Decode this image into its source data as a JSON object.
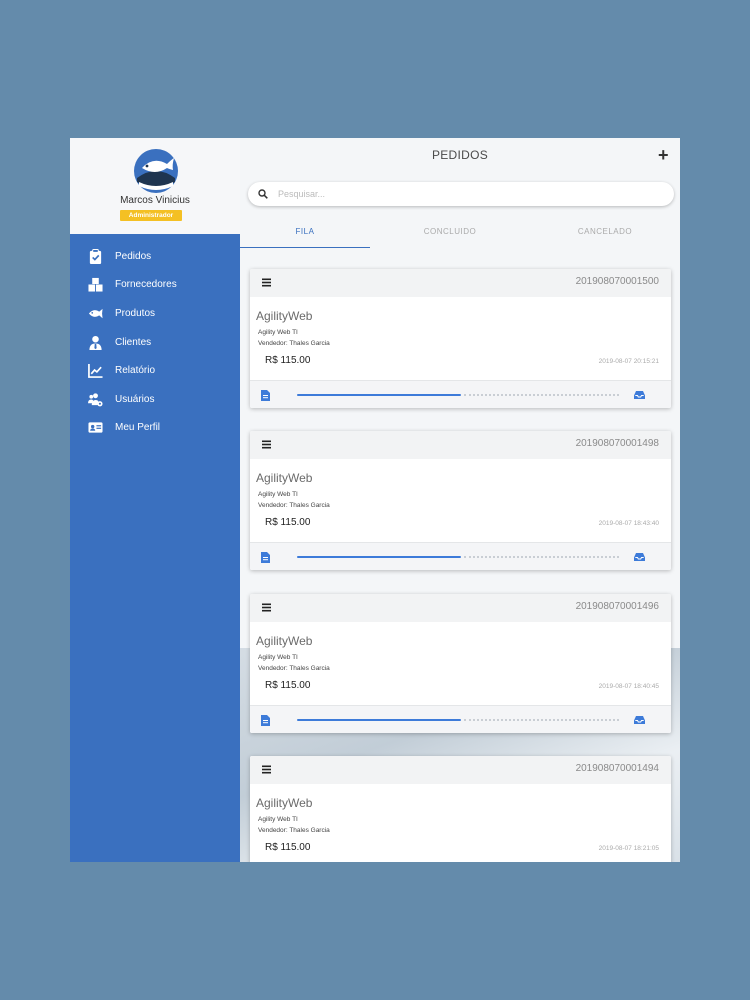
{
  "user": {
    "name": "Marcos Vinicius",
    "role": "Administrador"
  },
  "nav": [
    {
      "label": "Pedidos",
      "icon": "clipboard-check-icon"
    },
    {
      "label": "Fornecedores",
      "icon": "boxes-icon"
    },
    {
      "label": "Produtos",
      "icon": "fish-icon"
    },
    {
      "label": "Clientes",
      "icon": "user-tie-icon"
    },
    {
      "label": "Relatório",
      "icon": "chart-line-icon"
    },
    {
      "label": "Usuários",
      "icon": "users-cog-icon"
    },
    {
      "label": "Meu Perfil",
      "icon": "id-card-icon"
    }
  ],
  "header": {
    "title": "PEDIDOS",
    "add_label": "+"
  },
  "search": {
    "placeholder": "Pesquisar..."
  },
  "tabs": [
    {
      "label": "FILA",
      "active": true
    },
    {
      "label": "CONCLUIDO",
      "active": false
    },
    {
      "label": "CANCELADO",
      "active": false
    }
  ],
  "colors": {
    "accent": "#3a70bf",
    "badge": "#f4c024",
    "background": "#648bab",
    "progress": "#3d7bd9"
  },
  "orders": [
    {
      "id": "201908070001500",
      "brand": "AgilityWeb",
      "company": "Agility Web TI",
      "seller": "Vendedor: Thales Garcia",
      "price": "R$ 115.00",
      "date": "2019-08-07 20:15:21",
      "progress": 0.51
    },
    {
      "id": "201908070001498",
      "brand": "AgilityWeb",
      "company": "Agility Web TI",
      "seller": "Vendedor: Thales Garcia",
      "price": "R$ 115.00",
      "date": "2019-08-07 18:43:40",
      "progress": 0.51
    },
    {
      "id": "201908070001496",
      "brand": "AgilityWeb",
      "company": "Agility Web TI",
      "seller": "Vendedor: Thales Garcia",
      "price": "R$ 115.00",
      "date": "2019-08-07 18:40:45",
      "progress": 0.51
    },
    {
      "id": "201908070001494",
      "brand": "AgilityWeb",
      "company": "Agility Web TI",
      "seller": "Vendedor: Thales Garcia",
      "price": "R$ 115.00",
      "date": "2019-08-07 18:21:05",
      "progress": 0.51
    }
  ]
}
